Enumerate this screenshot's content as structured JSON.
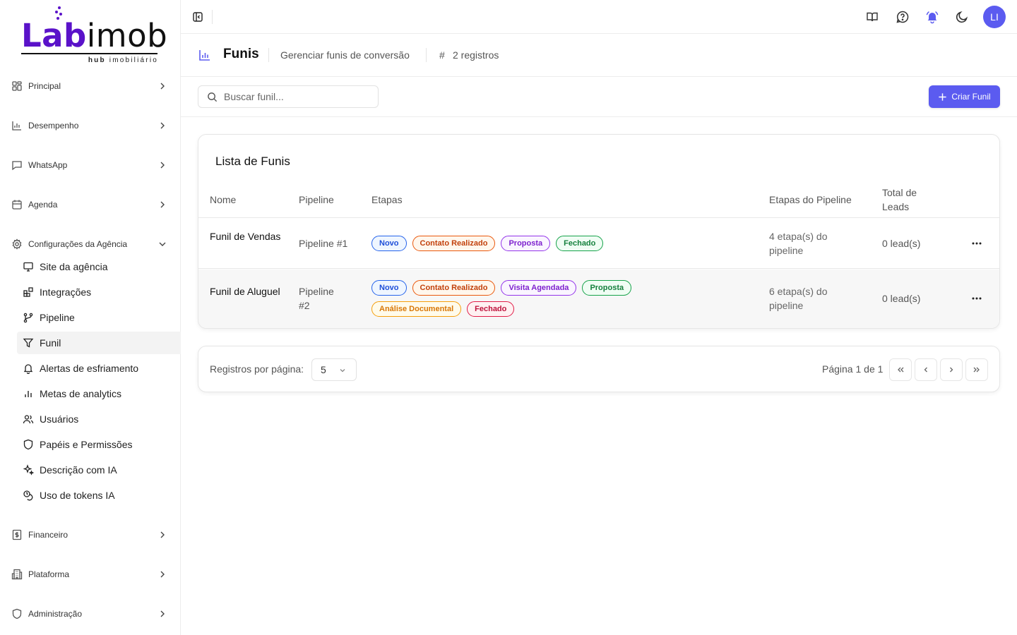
{
  "logo": {
    "part1": "Lab",
    "part2": "imob",
    "subtitle_bold": "hub",
    "subtitle_rest": "imobiliário",
    "brand_color": "#5a12c9"
  },
  "sidebar": {
    "groups_top": [
      {
        "label": "Principal",
        "icon": "layout-grid-icon"
      },
      {
        "label": "Desempenho",
        "icon": "bar-chart-icon"
      },
      {
        "label": "WhatsApp",
        "icon": "message-square-icon"
      },
      {
        "label": "Agenda",
        "icon": "calendar-icon"
      }
    ],
    "expanded_group": {
      "label": "Configurações da Agência",
      "icon": "gear-icon"
    },
    "items": [
      {
        "label": "Site da agência",
        "icon": "monitor-icon"
      },
      {
        "label": "Integrações",
        "icon": "blocks-icon"
      },
      {
        "label": "Pipeline",
        "icon": "git-branch-icon"
      },
      {
        "label": "Funil",
        "icon": "filter-icon",
        "active": true
      },
      {
        "label": "Alertas de esfriamento",
        "icon": "bell-icon"
      },
      {
        "label": "Metas de analytics",
        "icon": "bar-chart-icon"
      },
      {
        "label": "Usuários",
        "icon": "users-icon"
      },
      {
        "label": "Papéis e Permissões",
        "icon": "shield-icon"
      },
      {
        "label": "Descrição com IA",
        "icon": "sparkles-icon"
      },
      {
        "label": "Uso de tokens IA",
        "icon": "coins-icon"
      }
    ],
    "groups_bottom": [
      {
        "label": "Financeiro",
        "icon": "receipt-icon"
      },
      {
        "label": "Plataforma",
        "icon": "building-icon"
      },
      {
        "label": "Administração",
        "icon": "shield-icon"
      }
    ]
  },
  "topbar": {
    "avatar_initials": "LI",
    "accent": "#5b5bf0"
  },
  "page": {
    "title": "Funis",
    "description": "Gerenciar funis de conversão",
    "hash": "#",
    "count": "2 registros"
  },
  "toolbar": {
    "search_placeholder": "Buscar funil...",
    "search_value": "",
    "create_label": "Criar Funil"
  },
  "table": {
    "title": "Lista de Funis",
    "headers": {
      "name": "Nome",
      "pipeline": "Pipeline",
      "stages": "Etapas",
      "pipeline_stages": "Etapas do Pipeline",
      "total_leads": "Total de Leads"
    },
    "rows": [
      {
        "name": "Funil de Vendas",
        "pipeline": "Pipeline #1",
        "stages": [
          {
            "label": "Novo",
            "color": "blue"
          },
          {
            "label": "Contato Realizado",
            "color": "orange"
          },
          {
            "label": "Proposta",
            "color": "purple"
          },
          {
            "label": "Fechado",
            "color": "green"
          }
        ],
        "pipeline_stages": "4 etapa(s) do pipeline",
        "total_leads": "0 lead(s)"
      },
      {
        "name": "Funil de Aluguel",
        "pipeline": "Pipeline #2",
        "stages": [
          {
            "label": "Novo",
            "color": "blue"
          },
          {
            "label": "Contato Realizado",
            "color": "orange"
          },
          {
            "label": "Visita Agendada",
            "color": "purple"
          },
          {
            "label": "Proposta",
            "color": "green"
          },
          {
            "label": "Análise Documental",
            "color": "amber"
          },
          {
            "label": "Fechado",
            "color": "pink"
          }
        ],
        "pipeline_stages": "6 etapa(s) do pipeline",
        "total_leads": "0 lead(s)"
      }
    ]
  },
  "tag_colors": {
    "blue": {
      "text": "#1d4ed8",
      "border": "#2563eb",
      "bg": "#eff6ff"
    },
    "orange": {
      "text": "#c2410c",
      "border": "#ea580c",
      "bg": "#fff7ed"
    },
    "purple": {
      "text": "#7e22ce",
      "border": "#9333ea",
      "bg": "#faf5ff"
    },
    "green": {
      "text": "#15803d",
      "border": "#16a34a",
      "bg": "#f0fdf4"
    },
    "amber": {
      "text": "#d97706",
      "border": "#f59e0b",
      "bg": "#fffbeb"
    },
    "pink": {
      "text": "#be123c",
      "border": "#e11d48",
      "bg": "#fff1f2"
    }
  },
  "pagination": {
    "per_page_label": "Registros por página:",
    "per_page_value": "5",
    "page_info": "Página 1 de 1"
  }
}
